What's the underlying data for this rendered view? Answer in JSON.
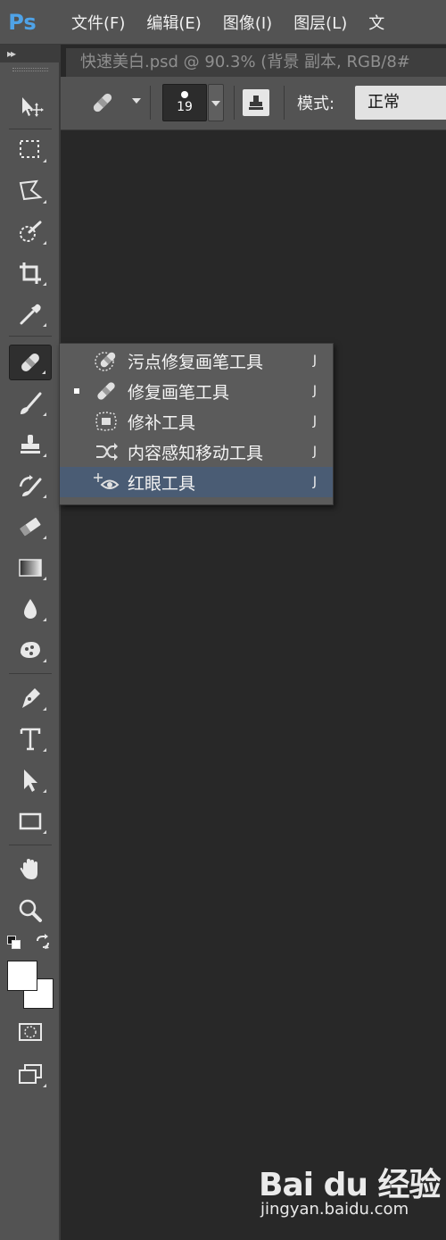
{
  "app": {
    "logo": "Ps",
    "brand_color": "#4fa3e8"
  },
  "menubar": {
    "items": [
      "文件(F)",
      "编辑(E)",
      "图像(I)",
      "图层(L)",
      "文"
    ]
  },
  "toolbar": {
    "collapse_glyph": "▸▸"
  },
  "document": {
    "tab_title": "快速美白.psd @ 90.3% (背景 副本, RGB/8#"
  },
  "options_bar": {
    "brush_size": "19",
    "mode_label": "模式:",
    "mode_value": "正常"
  },
  "flyout": {
    "items": [
      {
        "label": "污点修复画笔工具",
        "shortcut": "J",
        "active": false,
        "selected": false,
        "icon": "spot-healing-brush-icon"
      },
      {
        "label": "修复画笔工具",
        "shortcut": "J",
        "active": true,
        "selected": false,
        "icon": "healing-brush-icon"
      },
      {
        "label": "修补工具",
        "shortcut": "J",
        "active": false,
        "selected": false,
        "icon": "patch-icon"
      },
      {
        "label": "内容感知移动工具",
        "shortcut": "J",
        "active": false,
        "selected": false,
        "icon": "content-aware-move-icon"
      },
      {
        "label": "红眼工具",
        "shortcut": "J",
        "active": false,
        "selected": true,
        "icon": "red-eye-icon"
      }
    ]
  },
  "colors": {
    "foreground": "#ffffff",
    "background": "#ffffff",
    "selection": "#4a5c74"
  },
  "watermark": {
    "logo": "Bai du 经验",
    "site": "jingyan.baidu.com"
  }
}
